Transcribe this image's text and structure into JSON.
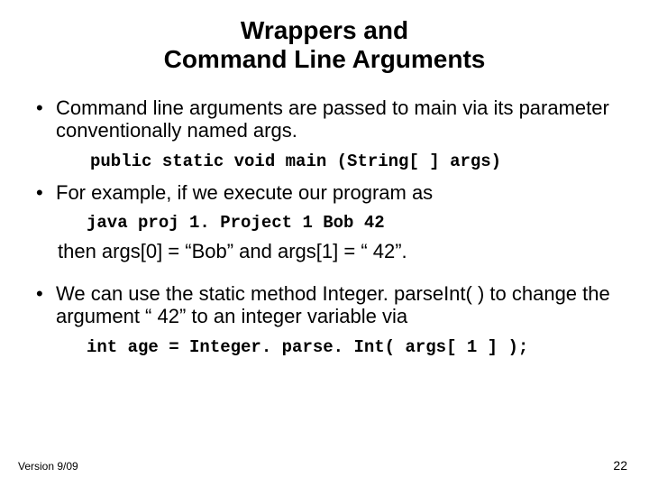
{
  "title_line1": "Wrappers and",
  "title_line2": "Command Line Arguments",
  "bullet1": "Command line arguments are passed to main via its parameter conventionally named args.",
  "code1": "public static void main (String[ ] args)",
  "bullet2": "For example, if we execute our program as",
  "code2": "java proj 1. Project 1 Bob 42",
  "then_line": "then args[0] = “Bob” and args[1] = “ 42”.",
  "bullet3": "We can use the static method Integer. parseInt( ) to change the argument “ 42” to an integer variable via",
  "code3": "int age = Integer. parse. Int( args[ 1 ] );",
  "footer_left": "Version 9/09",
  "footer_right": "22"
}
